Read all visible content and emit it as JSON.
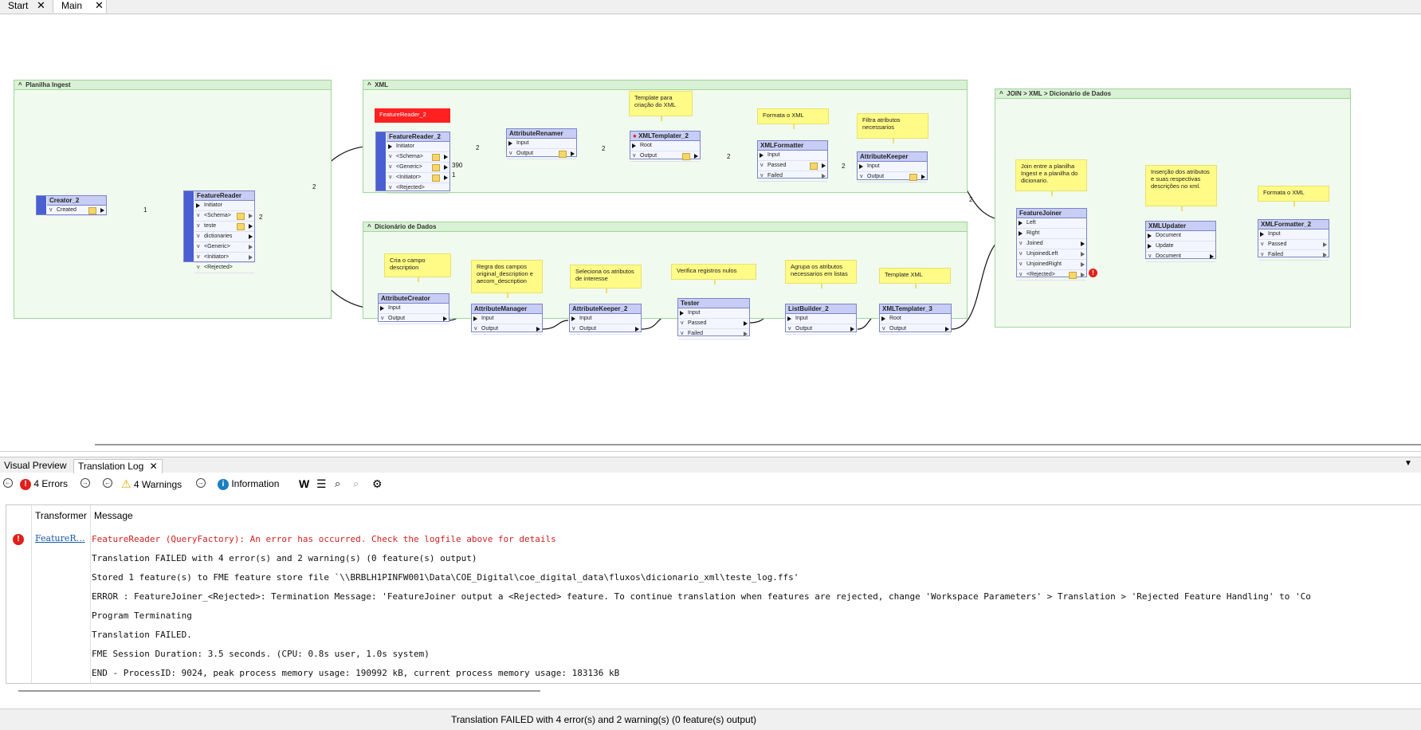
{
  "document_tabs": [
    {
      "label": "Start"
    },
    {
      "label": "Main"
    }
  ],
  "bookmarks": {
    "planilha": "Planilha Ingest",
    "xml": "XML",
    "dicionario": "Dicionário de Dados",
    "join": "JOIN > XML > Dicionário de Dados"
  },
  "nodes": {
    "creator2": {
      "title": "Creator_2",
      "ports": [
        "Created"
      ]
    },
    "featurereader": {
      "title": "FeatureReader",
      "ports": [
        "Initiator",
        "<Schema>",
        "teste",
        "dictionaries",
        "<Generic>",
        "<Initiator>",
        "<Rejected>"
      ]
    },
    "featurereader2": {
      "title": "FeatureReader_2",
      "ports": [
        "Initiator",
        "<Schema>",
        "<Generic>",
        "<Initiator>",
        "<Rejected>"
      ]
    },
    "attributerenamer": {
      "title": "AttributeRenamer",
      "ports": [
        "Input",
        "Output"
      ]
    },
    "xmltemplater2": {
      "title": "XMLTemplater_2",
      "ports": [
        "Root",
        "Output"
      ]
    },
    "xmlformatter": {
      "title": "XMLFormatter",
      "ports": [
        "Input",
        "Passed",
        "Failed"
      ]
    },
    "attributekeeper": {
      "title": "AttributeKeeper",
      "ports": [
        "Input",
        "Output"
      ]
    },
    "attributecreator": {
      "title": "AttributeCreator",
      "ports": [
        "Input",
        "Output"
      ]
    },
    "attributemanager": {
      "title": "AttributeManager",
      "ports": [
        "Input",
        "Output"
      ]
    },
    "attributekeeper2": {
      "title": "AttributeKeeper_2",
      "ports": [
        "Input",
        "Output"
      ]
    },
    "tester": {
      "title": "Tester",
      "ports": [
        "Input",
        "Passed",
        "Failed"
      ]
    },
    "listbuilder2": {
      "title": "ListBuilder_2",
      "ports": [
        "Input",
        "Output"
      ]
    },
    "xmltemplater3": {
      "title": "XMLTemplater_3",
      "ports": [
        "Root",
        "Output"
      ]
    },
    "featurejoiner": {
      "title": "FeatureJoiner",
      "ports": [
        "Left",
        "Right",
        "Joined",
        "UnjoinedLeft",
        "UnjoinedRight",
        "<Rejected>"
      ]
    },
    "xmlupdater": {
      "title": "XMLUpdater",
      "ports": [
        "Document",
        "Update",
        "Document"
      ]
    },
    "xmlformatter2": {
      "title": "XMLFormatter_2",
      "ports": [
        "Input",
        "Passed",
        "Failed"
      ]
    }
  },
  "annotations": {
    "fr2_error": "FeatureReader_2",
    "template_xml": "Template para criação do XML",
    "formata_xml": "Formata o XML",
    "filtra": "Filtra atributos necessarios",
    "cria_campo": "Cria o campo description",
    "regra": "Regra dos campos original_description e aecom_description",
    "seleciona": "Seleciona os atributos de interesse",
    "verifica": "Verifica registros nulos",
    "agrupa": "Agrupa os atributos necessarios em listas",
    "template_xml2": "Template XML",
    "join": "Join entre a planilha Ingest e a planilha do dicionario.",
    "insercao": "Inserção dos atributos e suas respectivas descrições no xml.",
    "formata_xml2": "Formata o XML"
  },
  "counts": {
    "c1": "1",
    "c2": "2",
    "c3": "2",
    "c4": "2",
    "c5": "2",
    "c6": "2",
    "c7": "2",
    "c8": "390",
    "c9": "1"
  },
  "panel_tabs": [
    {
      "label": "Visual Preview"
    },
    {
      "label": "Translation Log"
    }
  ],
  "toolbar": {
    "errors": "4 Errors",
    "warnings": "4 Warnings",
    "information": "Information"
  },
  "log": {
    "col_transformer": "Transformer",
    "col_message": "Message",
    "transformer_link": "FeatureR…",
    "lines": [
      "FeatureReader (QueryFactory): An error has occurred. Check the logfile above for details",
      "Translation FAILED with 4 error(s) and 2 warning(s) (0 feature(s) output)",
      "Stored 1 feature(s) to FME feature store file `\\\\BRBLH1PINFW001\\Data\\COE_Digital\\coe_digital_data\\fluxos\\dicionario_xml\\teste_log.ffs'",
      "ERROR : FeatureJoiner_<Rejected>: Termination Message: 'FeatureJoiner output a <Rejected> feature.  To continue translation when features are rejected, change 'Workspace Parameters' > Translation > 'Rejected Feature Handling' to 'Co",
      "Program Terminating",
      "Translation FAILED.",
      "FME Session Duration: 3.5 seconds. (CPU: 0.8s user, 1.0s system)",
      "END - ProcessID: 9024, peak process memory usage: 190992 kB, current process memory usage: 183136 kB"
    ]
  },
  "status_bar": "Translation FAILED with 4 error(s) and 2 warning(s) (0 feature(s) output)",
  "colors": {
    "error": "#e0201c",
    "link": "#1a5aa6",
    "bookmark": "#d9f1d4",
    "note": "#fffb86"
  }
}
